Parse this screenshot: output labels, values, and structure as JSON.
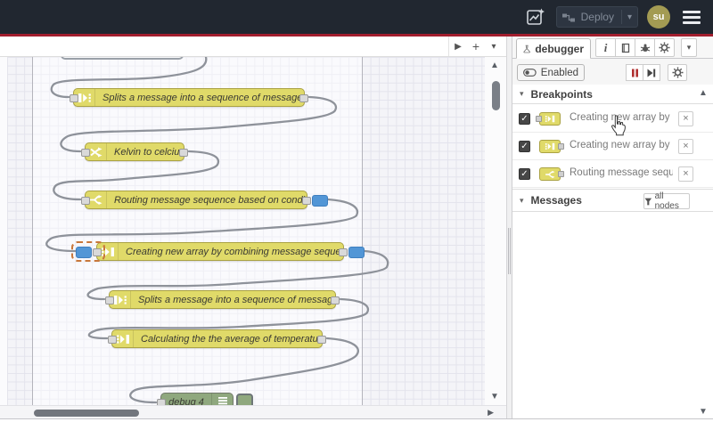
{
  "header": {
    "deploy_label": "Deploy",
    "avatar_initials": "su"
  },
  "glyphs": {
    "play": "▶",
    "plus": "+",
    "caret_down": "▾",
    "arrow_up": "▲",
    "arrow_down": "▼",
    "arrow_right": "▶",
    "check": "✓",
    "close": "×",
    "info": "i"
  },
  "canvas": {
    "nodes": [
      {
        "type": "split",
        "label": "Splits a message into a sequence of messages."
      },
      {
        "type": "change",
        "label": "Kelvin to celcius"
      },
      {
        "type": "switch",
        "label": "Routing message sequence based on condition",
        "breakpoints": [
          "output"
        ]
      },
      {
        "type": "join",
        "label": "Creating new array by combining message sequence",
        "breakpoints": [
          "input",
          "output"
        ],
        "selected_breakpoint": "input"
      },
      {
        "type": "split",
        "label": "Splits a message into a sequence of messages."
      },
      {
        "type": "join",
        "label": "Calculating the the average of temperature"
      },
      {
        "type": "debug",
        "label": "debug 4"
      }
    ]
  },
  "sidebar": {
    "tab_label": "debugger",
    "enabled_label": "Enabled",
    "breakpoints": {
      "title": "Breakpoints",
      "items": [
        {
          "checked": true,
          "node_type": "join",
          "port": "input",
          "label": "Creating new array by combining message sequence"
        },
        {
          "checked": true,
          "node_type": "join",
          "port": "output",
          "label": "Creating new array by combining message sequence"
        },
        {
          "checked": true,
          "node_type": "switch",
          "port": "output",
          "label": "Routing message sequence based on condition"
        }
      ]
    },
    "messages": {
      "title": "Messages",
      "filter_label": "all nodes"
    }
  },
  "colors": {
    "header_bg": "#212730",
    "deploy_bar_red": "#a21e2e",
    "node_yellow": "#e0da69",
    "node_green": "#8fa87e",
    "breakpoint_blue": "#5296d6",
    "breakpoint_ring_orange": "#c8773b",
    "avatar_olive": "#a39b53"
  }
}
